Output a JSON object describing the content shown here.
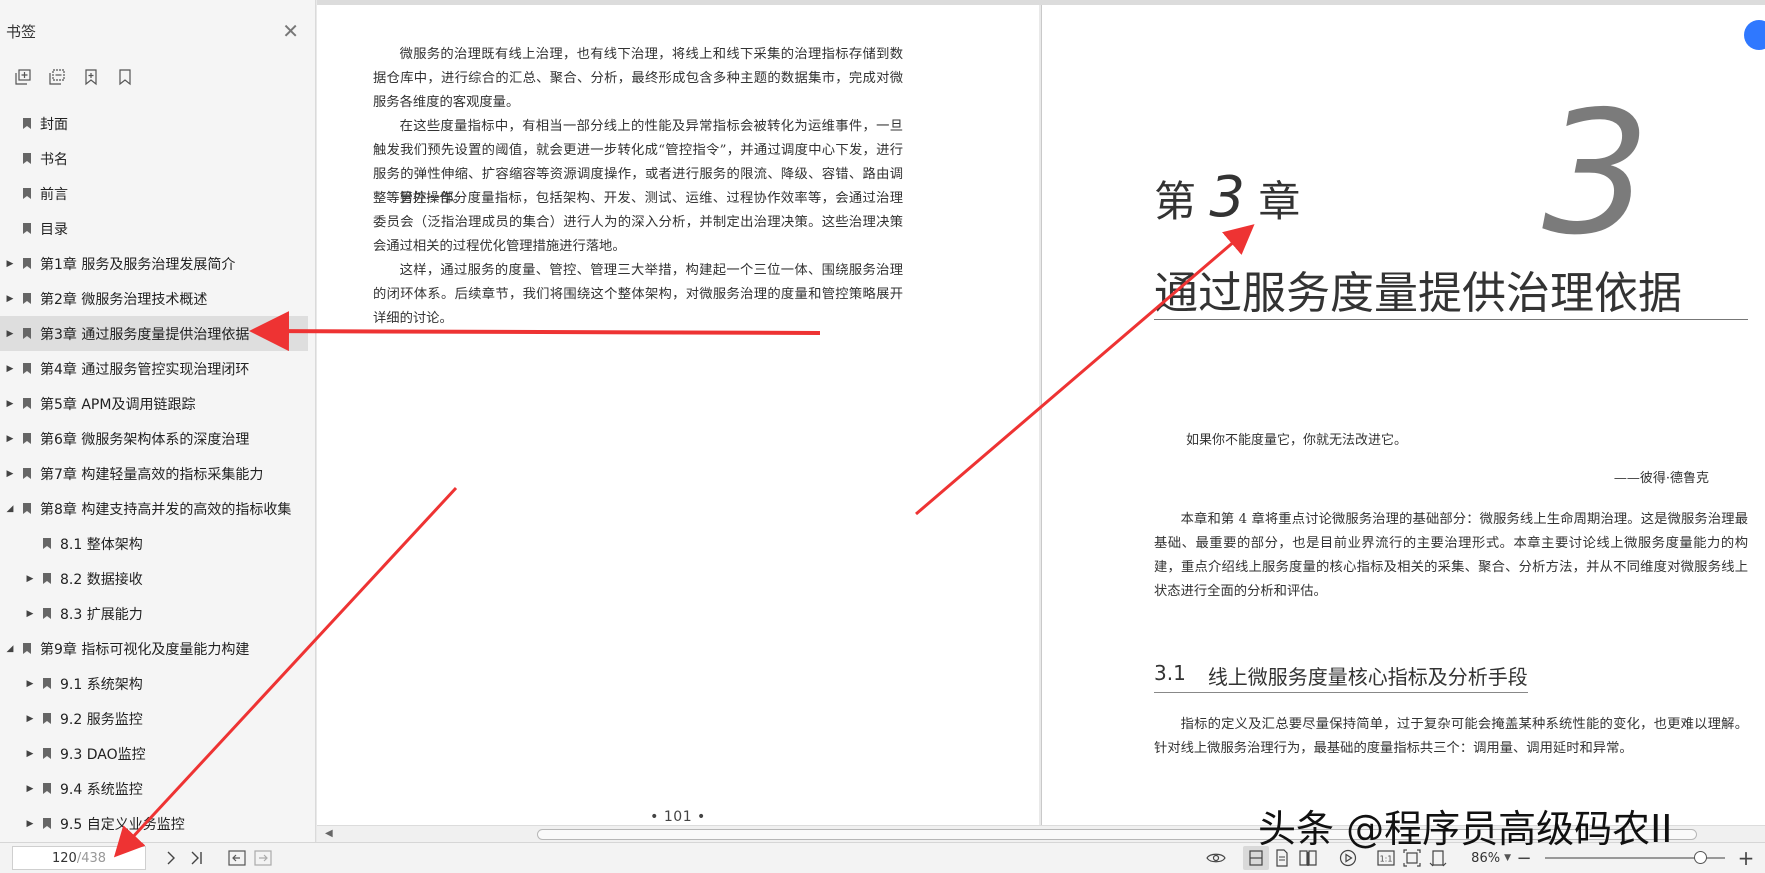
{
  "sidebar": {
    "title": "书签",
    "close_icon": "close-icon",
    "toolbar": [
      "expand-all-icon",
      "collapse-all-icon",
      "add-bookmark-icon",
      "bookmark-icon"
    ],
    "items": [
      {
        "label": "封面",
        "level": 0,
        "toggle": "none",
        "selected": false
      },
      {
        "label": "书名",
        "level": 0,
        "toggle": "none",
        "selected": false
      },
      {
        "label": "前言",
        "level": 0,
        "toggle": "none",
        "selected": false
      },
      {
        "label": "目录",
        "level": 0,
        "toggle": "none",
        "selected": false
      },
      {
        "label": "第1章 服务及服务治理发展简介",
        "level": 0,
        "toggle": "collapsed",
        "selected": false
      },
      {
        "label": "第2章 微服务治理技术概述",
        "level": 0,
        "toggle": "collapsed",
        "selected": false
      },
      {
        "label": "第3章 通过服务度量提供治理依据",
        "level": 0,
        "toggle": "collapsed",
        "selected": true
      },
      {
        "label": "第4章 通过服务管控实现治理闭环",
        "level": 0,
        "toggle": "collapsed",
        "selected": false
      },
      {
        "label": "第5章 APM及调用链跟踪",
        "level": 0,
        "toggle": "collapsed",
        "selected": false
      },
      {
        "label": "第6章 微服务架构体系的深度治理",
        "level": 0,
        "toggle": "collapsed",
        "selected": false
      },
      {
        "label": "第7章 构建轻量高效的指标采集能力",
        "level": 0,
        "toggle": "collapsed",
        "selected": false
      },
      {
        "label": "第8章 构建支持高并发的高效的指标收集",
        "level": 0,
        "toggle": "expanded",
        "selected": false
      },
      {
        "label": "8.1 整体架构",
        "level": 1,
        "toggle": "none",
        "selected": false
      },
      {
        "label": "8.2 数据接收",
        "level": 1,
        "toggle": "collapsed",
        "selected": false
      },
      {
        "label": "8.3 扩展能力",
        "level": 1,
        "toggle": "collapsed",
        "selected": false
      },
      {
        "label": "第9章 指标可视化及度量能力构建",
        "level": 0,
        "toggle": "expanded",
        "selected": false
      },
      {
        "label": "9.1 系统架构",
        "level": 1,
        "toggle": "collapsed",
        "selected": false
      },
      {
        "label": "9.2 服务监控",
        "level": 1,
        "toggle": "collapsed",
        "selected": false
      },
      {
        "label": "9.3 DAO监控",
        "level": 1,
        "toggle": "collapsed",
        "selected": false
      },
      {
        "label": "9.4 系统监控",
        "level": 1,
        "toggle": "collapsed",
        "selected": false
      },
      {
        "label": "9.5 自定义业务监控",
        "level": 1,
        "toggle": "collapsed",
        "selected": false
      }
    ]
  },
  "left_page": {
    "paragraphs": [
      "微服务的治理既有线上治理，也有线下治理，将线上和线下采集的治理指标存储到数据仓库中，进行综合的汇总、聚合、分析，最终形成包含多种主题的数据集市，完成对微服务各维度的客观度量。",
      "在这些度量指标中，有相当一部分线上的性能及异常指标会被转化为运维事件，一旦触发我们预先设置的阈值，就会更进一步转化成“管控指令”，并通过调度中心下发，进行服务的弹性伸缩、扩容缩容等资源调度操作，或者进行服务的限流、降级、容错、路由调整等管控操作。",
      "另外一部分度量指标，包括架构、开发、测试、运维、过程协作效率等，会通过治理委员会（泛指治理成员的集合）进行人为的深入分析，并制定出治理决策。这些治理决策会通过相关的过程优化管理措施进行落地。",
      "这样，通过服务的度量、管控、管理三大举措，构建起一个三位一体、围绕服务治理的闭环体系。后续章节，我们将围绕这个整体架构，对微服务治理的度量和管控策略展开详细的讨论。"
    ],
    "page_number": "• 101 •"
  },
  "right_page": {
    "chapter_prefix": "第",
    "chapter_number": "3",
    "chapter_suffix": "章",
    "chapter_big_number": "3",
    "chapter_title": "通过服务度量提供治理依据",
    "quote": "如果你不能度量它，你就无法改进它。",
    "quote_author": "——彼得·德鲁克",
    "intro": "本章和第 4 章将重点讨论微服务治理的基础部分：微服务线上生命周期治理。这是微服务治理最基础、最重要的部分，也是目前业界流行的主要治理形式。本章主要讨论线上微服务度量能力的构建，重点介绍线上服务度量的核心指标及相关的采集、聚合、分析方法，并从不同维度对微服务线上状态进行全面的分析和评估。",
    "section_number": "3.1",
    "section_title": "线上微服务度量核心指标及分析手段",
    "section_body": "指标的定义及汇总要尽量保持简单，过于复杂可能会掩盖某种系统性能的变化，也更难以理解。针对线上微服务治理行为，最基础的度量指标共三个：调用量、调用延时和异常。"
  },
  "statusbar": {
    "current_page": "120",
    "total_pages": "/438",
    "zoom": "86%",
    "zoom_level": 0.86
  },
  "watermark": "头条 @程序员高级码农II",
  "colors": {
    "annotation_arrow": "#ee3333",
    "selected_row": "#dedede",
    "accent": "#2f78ff"
  }
}
